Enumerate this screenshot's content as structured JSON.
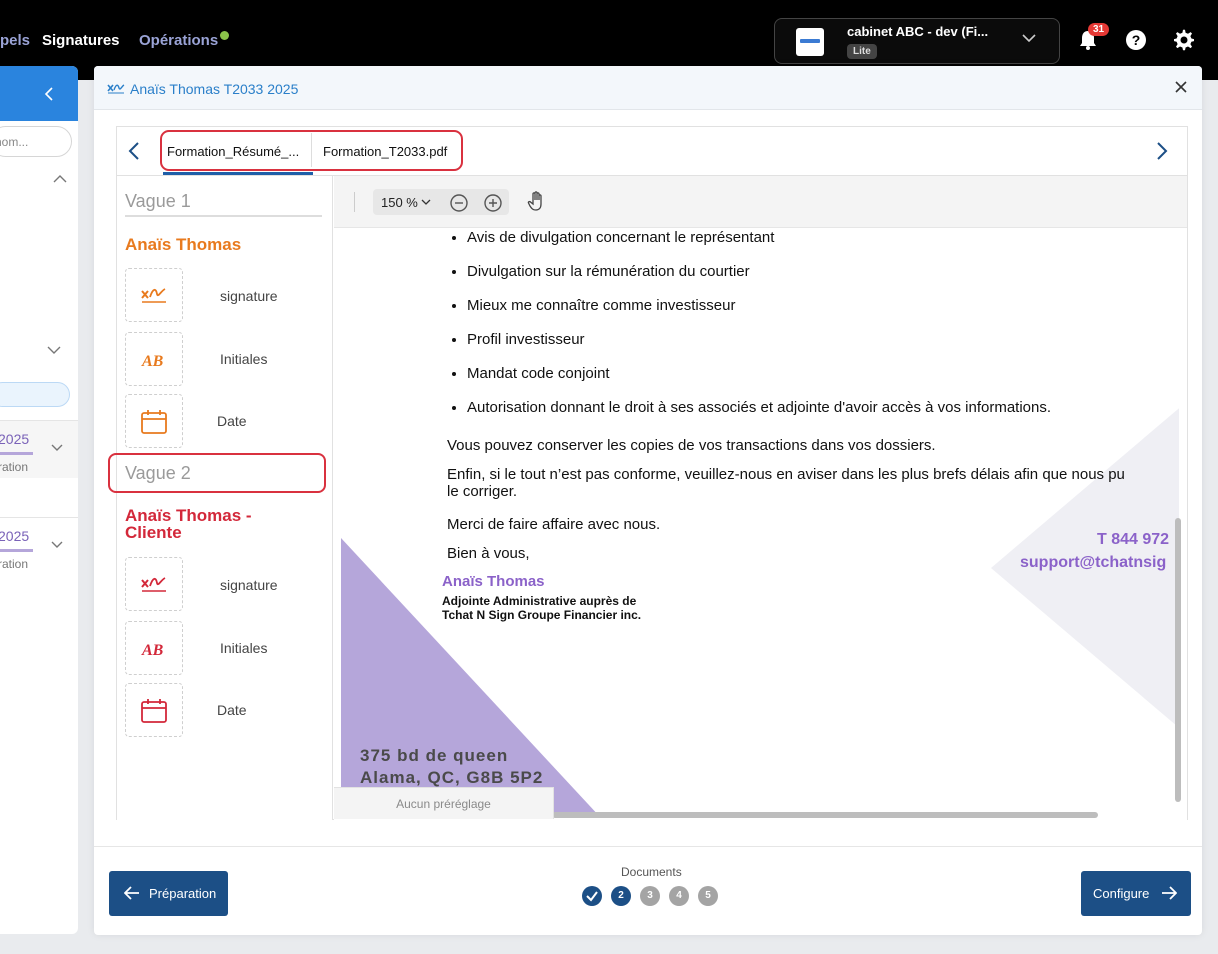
{
  "topbar": {
    "nav": [
      {
        "label": "pels"
      },
      {
        "label": "Signatures"
      },
      {
        "label": "Opérations"
      }
    ],
    "org": {
      "name": "cabinet ABC - dev (Fi...",
      "badge": "Lite"
    },
    "notifications_count": "31",
    "icons": [
      "bell-icon",
      "help-icon",
      "gear-icon",
      "chevron-down-icon"
    ]
  },
  "background_panel": {
    "search_placeholder": "nom...",
    "rows": [
      {
        "year": "2025",
        "sub": "ration"
      },
      {
        "year": "2025",
        "sub": "ration"
      }
    ]
  },
  "modal": {
    "title": "Anaïs Thomas T2033 2025",
    "tabs": [
      {
        "label": "Formation_Résumé_...",
        "active": true
      },
      {
        "label": "Formation_T2033.pdf",
        "active": false
      }
    ],
    "waves": [
      {
        "label": "Vague 1",
        "signer": "Anaïs Thomas",
        "color": "#e87a1e",
        "fields": [
          {
            "label": "signature",
            "icon": "signature-icon"
          },
          {
            "label": "Initiales",
            "icon": "initials-icon"
          },
          {
            "label": "Date",
            "icon": "calendar-icon"
          }
        ]
      },
      {
        "label": "Vague 2",
        "signer_line1": "Anaïs Thomas -",
        "signer_line2": "Cliente",
        "color": "#d3283a",
        "fields": [
          {
            "label": "signature",
            "icon": "signature-icon"
          },
          {
            "label": "Initiales",
            "icon": "initials-icon"
          },
          {
            "label": "Date",
            "icon": "calendar-icon"
          }
        ]
      }
    ],
    "viewer": {
      "zoom": "150 %",
      "bullets": [
        "Avis de divulgation concernant le représentant",
        "Divulgation sur la rémunération du courtier",
        "Mieux me connaître comme investisseur",
        "Profil investisseur",
        "Mandat code conjoint",
        "Autorisation donnant le droit à ses associés et adjointe d'avoir accès à vos informations."
      ],
      "para1": "Vous pouvez conserver les copies de vos transactions dans vos dossiers.",
      "para2_line1": "Enfin, si le tout n’est pas conforme, veuillez-nous en aviser dans les plus brefs délais afin que nous pu",
      "para2_line2": "le corriger.",
      "para3": "Merci de faire affaire avec nous.",
      "para4": "Bien à vous,",
      "sig_name": "Anaïs Thomas",
      "sig_title_line1": "Adjointe Administrative auprès de",
      "sig_title_line2": "Tchat N Sign Groupe Financier inc.",
      "phone": "T 844 972",
      "email": "support@tchatnsig",
      "address_line1": "375 bd de queen",
      "address_line2": "Alama, QC, G8B 5P2",
      "preset": "Aucun préréglage"
    },
    "footer": {
      "prev_label": "Préparation",
      "next_label": "Configure",
      "steps_label": "Documents",
      "steps": [
        "",
        "2",
        "3",
        "4",
        "5"
      ],
      "current_step": 2
    }
  },
  "colors": {
    "primary": "#1c4f86",
    "accent_blue": "#2a7fc9",
    "wave1": "#e87a1e",
    "wave2": "#d3283a",
    "purple": "#8b62c9",
    "highlight": "#d9313f"
  }
}
